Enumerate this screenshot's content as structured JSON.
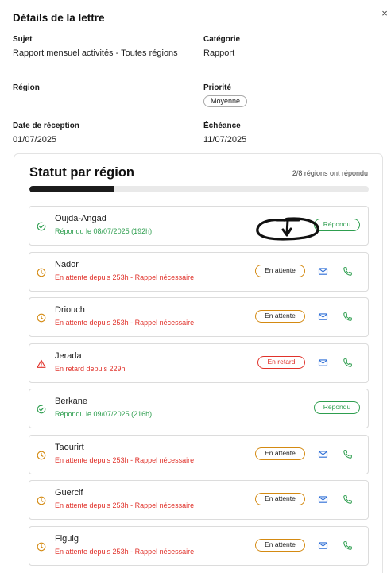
{
  "dialog": {
    "title": "Détails de la lettre",
    "close_glyph": "×"
  },
  "details": {
    "subject": {
      "label": "Sujet",
      "value": "Rapport mensuel activités - Toutes régions"
    },
    "category": {
      "label": "Catégorie",
      "value": "Rapport"
    },
    "region": {
      "label": "Région",
      "value": ""
    },
    "priority": {
      "label": "Priorité",
      "value": "Moyenne"
    },
    "reception": {
      "label": "Date de réception",
      "value": "01/07/2025"
    },
    "deadline": {
      "label": "Échéance",
      "value": "11/07/2025"
    }
  },
  "status": {
    "title": "Statut par région",
    "count_text": "2/8 régions ont répondu",
    "progress_fraction": 0.25
  },
  "regions": [
    {
      "name": "Oujda-Angad",
      "state": "answered",
      "sub": "Répondu le 08/07/2025 (192h)",
      "badge": "Répondu"
    },
    {
      "name": "Nador",
      "state": "pending",
      "sub": "En attente depuis 253h - Rappel nécessaire",
      "badge": "En attente"
    },
    {
      "name": "Driouch",
      "state": "pending",
      "sub": "En attente depuis 253h - Rappel nécessaire",
      "badge": "En attente"
    },
    {
      "name": "Jerada",
      "state": "late",
      "sub": "En retard depuis 229h",
      "badge": "En retard"
    },
    {
      "name": "Berkane",
      "state": "answered",
      "sub": "Répondu le 09/07/2025 (216h)",
      "badge": "Répondu"
    },
    {
      "name": "Taourirt",
      "state": "pending",
      "sub": "En attente depuis 253h - Rappel nécessaire",
      "badge": "En attente"
    },
    {
      "name": "Guercif",
      "state": "pending",
      "sub": "En attente depuis 253h - Rappel nécessaire",
      "badge": "En attente"
    },
    {
      "name": "Figuig",
      "state": "pending",
      "sub": "En attente depuis 253h - Rappel nécessaire",
      "badge": "En attente"
    }
  ],
  "icons": {
    "answered": "check-circle-icon",
    "pending": "clock-icon",
    "late": "warning-triangle-icon",
    "mail": "mail-icon",
    "phone": "phone-icon"
  },
  "colors": {
    "green": "#2e9e4f",
    "red": "#e0322b",
    "orange": "#d48a12",
    "blue": "#2f6fd6",
    "progress": "#1c1c1c"
  }
}
